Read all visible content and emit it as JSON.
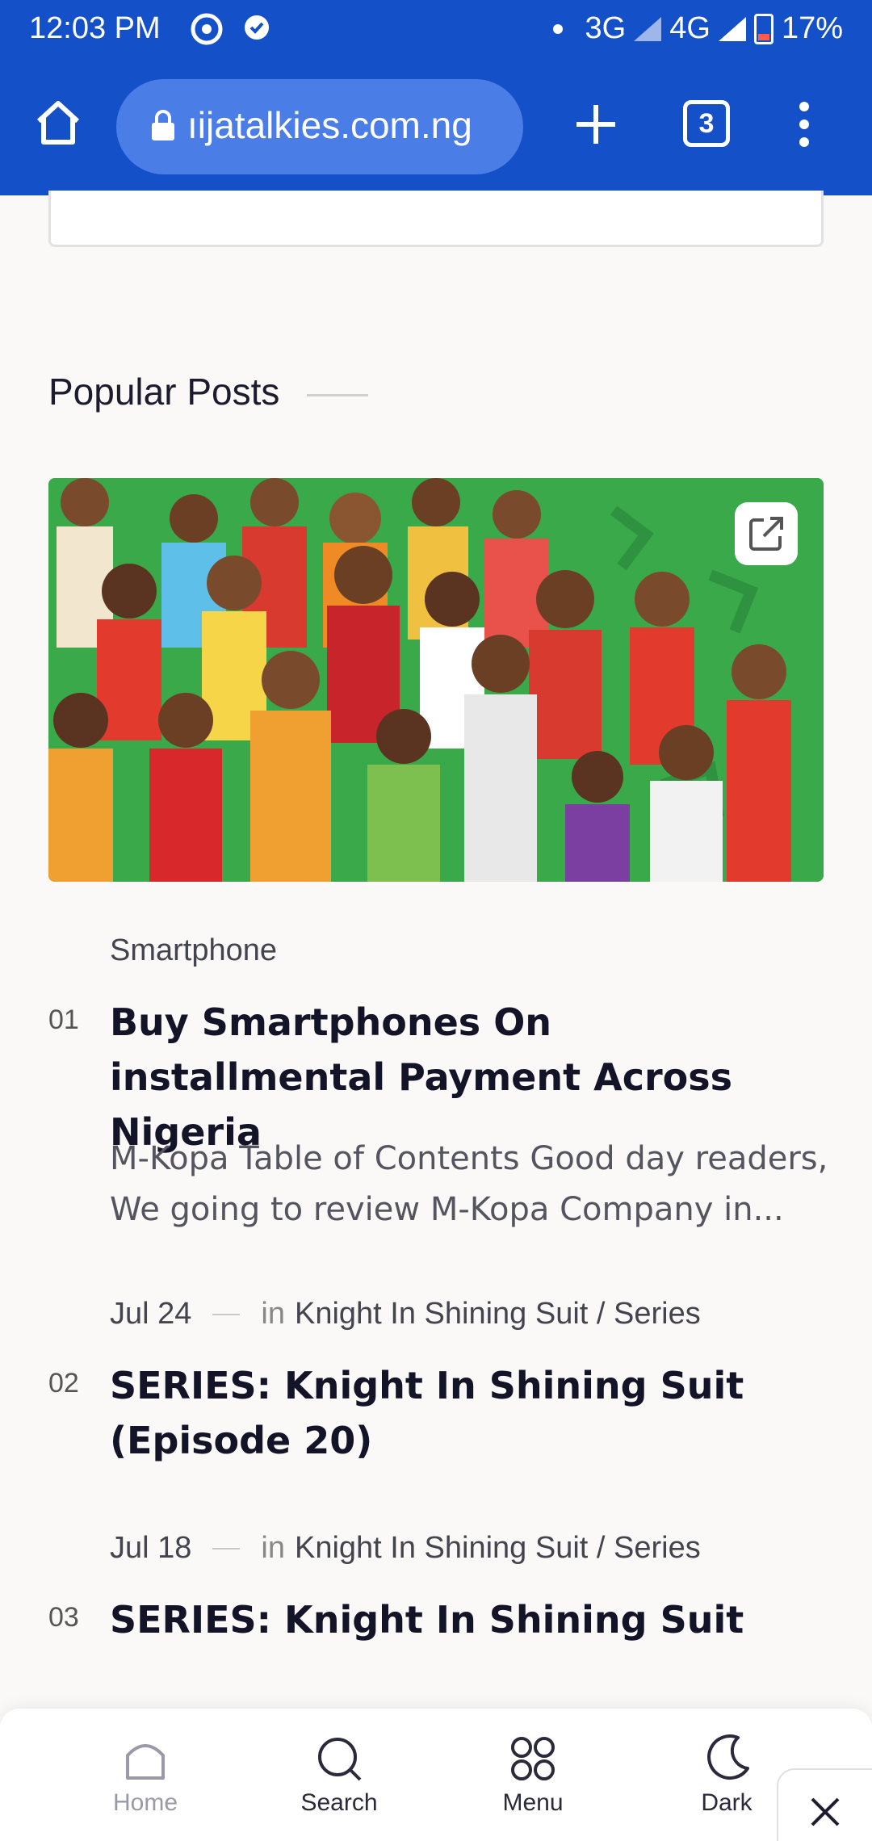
{
  "status_bar": {
    "time": "12:03 PM",
    "network_1": "3G",
    "network_2": "4G",
    "battery": "17%"
  },
  "browser": {
    "url": "ıijatalkies.com.ng",
    "tab_count": "3"
  },
  "section": {
    "title": "Popular Posts"
  },
  "posts": [
    {
      "number": "01",
      "category": "Smartphone",
      "title": "Buy Smartphones On installmental Payment Across Nigeria",
      "excerpt": "M-Kopa Table of Contents Good day readers, We going to review M-Kopa Company in..."
    },
    {
      "number": "02",
      "date": "Jul 24",
      "in": "in",
      "categories": "Knight In Shining Suit / Series",
      "title": "SERIES: Knight In Shining Suit (Episode 20)"
    },
    {
      "number": "03",
      "date": "Jul 18",
      "in": "in",
      "categories": "Knight In Shining Suit / Series",
      "title": "SERIES: Knight In Shining Suit"
    }
  ],
  "bottom_nav": {
    "items": [
      {
        "label": "Home",
        "icon": "home-icon"
      },
      {
        "label": "Search",
        "icon": "search-icon"
      },
      {
        "label": "Menu",
        "icon": "grid-icon"
      },
      {
        "label": "Dark",
        "icon": "moon-icon"
      }
    ]
  },
  "colors": {
    "chrome_blue": "#1450c8",
    "url_pill": "#4a7de6",
    "hero_green": "#3aa94a"
  }
}
